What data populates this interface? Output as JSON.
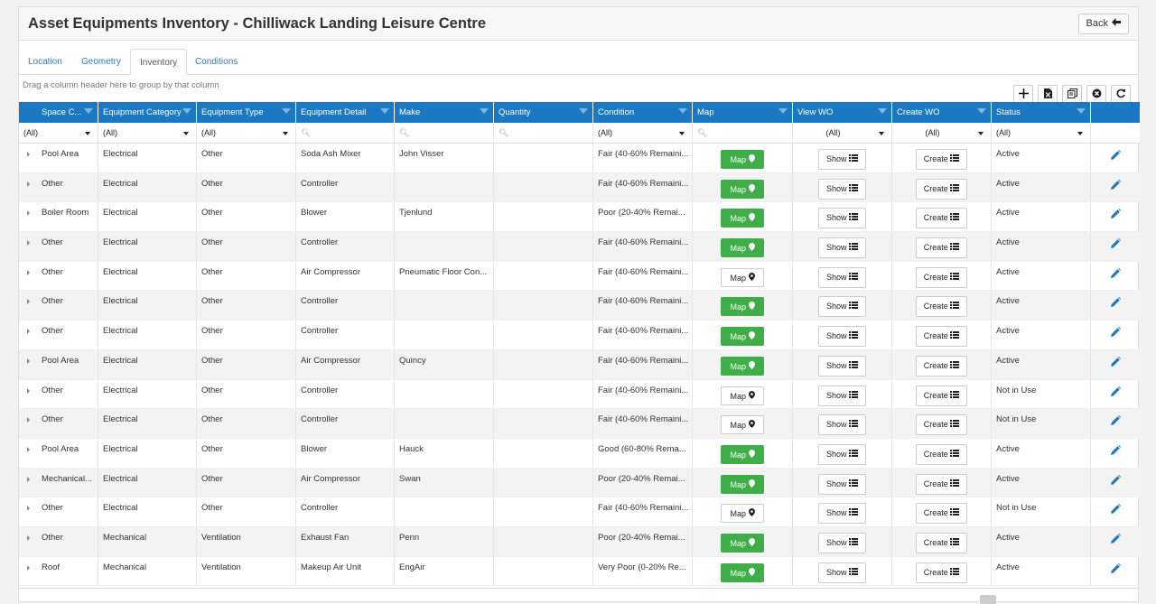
{
  "title": "Asset Equipments Inventory - Chilliwack Landing Leisure Centre",
  "back_label": "Back",
  "tabs": [
    {
      "label": "Location"
    },
    {
      "label": "Geometry"
    },
    {
      "label": "Inventory"
    },
    {
      "label": "Conditions"
    }
  ],
  "active_tab": "Inventory",
  "group_hint": "Drag a column header here to group by that column",
  "toolbar_icons": [
    "plus-icon",
    "excel-export-icon",
    "column-chooser-icon",
    "clear-filter-icon",
    "refresh-icon"
  ],
  "columns": [
    "Space C...",
    "Equipment Category",
    "Equipment Type",
    "Equipment Detail",
    "Make",
    "Quantity",
    "Condition",
    "Map",
    "View WO",
    "Create WO",
    "Status"
  ],
  "filters": {
    "space": "(All)",
    "category": "(All)",
    "type": "(All)",
    "condition": "(All)",
    "view_wo": "(All)",
    "create_wo": "(All)",
    "status": "(All)"
  },
  "buttons": {
    "map": "Map",
    "show": "Show",
    "create": "Create"
  },
  "colors": {
    "header_blue": "#1a79c2",
    "map_green": "#3fae49"
  },
  "rows": [
    {
      "space": "Pool Area",
      "category": "Electrical",
      "type": "Other",
      "detail": "Soda Ash Mixer",
      "make": "John Visser",
      "quantity": "",
      "condition": "Fair (40-60% Remaini...",
      "map_located": true,
      "status": "Active"
    },
    {
      "space": "Other",
      "category": "Electrical",
      "type": "Other",
      "detail": "Controller",
      "make": "",
      "quantity": "",
      "condition": "Fair (40-60% Remaini...",
      "map_located": true,
      "status": "Active"
    },
    {
      "space": "Boiler Room",
      "category": "Electrical",
      "type": "Other",
      "detail": "Blower",
      "make": "Tjenlund",
      "quantity": "",
      "condition": "Poor (20-40% Remai...",
      "map_located": true,
      "status": "Active"
    },
    {
      "space": "Other",
      "category": "Electrical",
      "type": "Other",
      "detail": "Controller",
      "make": "",
      "quantity": "",
      "condition": "Fair (40-60% Remaini...",
      "map_located": true,
      "status": "Active"
    },
    {
      "space": "Other",
      "category": "Electrical",
      "type": "Other",
      "detail": "Air Compressor",
      "make": "Pneumatic Floor Con...",
      "quantity": "",
      "condition": "Fair (40-60% Remaini...",
      "map_located": false,
      "status": "Active"
    },
    {
      "space": "Other",
      "category": "Electrical",
      "type": "Other",
      "detail": "Controller",
      "make": "",
      "quantity": "",
      "condition": "Fair (40-60% Remaini...",
      "map_located": true,
      "status": "Active"
    },
    {
      "space": "Other",
      "category": "Electrical",
      "type": "Other",
      "detail": "Controller",
      "make": "",
      "quantity": "",
      "condition": "Fair (40-60% Remaini...",
      "map_located": true,
      "status": "Active"
    },
    {
      "space": "Pool Area",
      "category": "Electrical",
      "type": "Other",
      "detail": "Air Compressor",
      "make": "Quincy",
      "quantity": "",
      "condition": "Fair (40-60% Remaini...",
      "map_located": true,
      "status": "Active"
    },
    {
      "space": "Other",
      "category": "Electrical",
      "type": "Other",
      "detail": "Controller",
      "make": "",
      "quantity": "",
      "condition": "Fair (40-60% Remaini...",
      "map_located": false,
      "status": "Not in Use"
    },
    {
      "space": "Other",
      "category": "Electrical",
      "type": "Other",
      "detail": "Controller",
      "make": "",
      "quantity": "",
      "condition": "Fair (40-60% Remaini...",
      "map_located": false,
      "status": "Not in Use"
    },
    {
      "space": "Pool Area",
      "category": "Electrical",
      "type": "Other",
      "detail": "Blower",
      "make": "Hauck",
      "quantity": "",
      "condition": "Good (60-80% Rema...",
      "map_located": true,
      "status": "Active"
    },
    {
      "space": "Mechanical...",
      "category": "Electrical",
      "type": "Other",
      "detail": "Air Compressor",
      "make": "Swan",
      "quantity": "",
      "condition": "Poor (20-40% Remai...",
      "map_located": true,
      "status": "Active"
    },
    {
      "space": "Other",
      "category": "Electrical",
      "type": "Other",
      "detail": "Controller",
      "make": "",
      "quantity": "",
      "condition": "Fair (40-60% Remaini...",
      "map_located": false,
      "status": "Not in Use"
    },
    {
      "space": "Other",
      "category": "Mechanical",
      "type": "Ventilation",
      "detail": "Exhaust Fan",
      "make": "Penn",
      "quantity": "",
      "condition": "Poor (20-40% Remai...",
      "map_located": true,
      "status": "Active"
    },
    {
      "space": "Roof",
      "category": "Mechanical",
      "type": "Ventilation",
      "detail": "Makeup Air Unit",
      "make": "EngAir",
      "quantity": "",
      "condition": "Very Poor (0-20% Re...",
      "map_located": true,
      "status": "Active"
    }
  ]
}
